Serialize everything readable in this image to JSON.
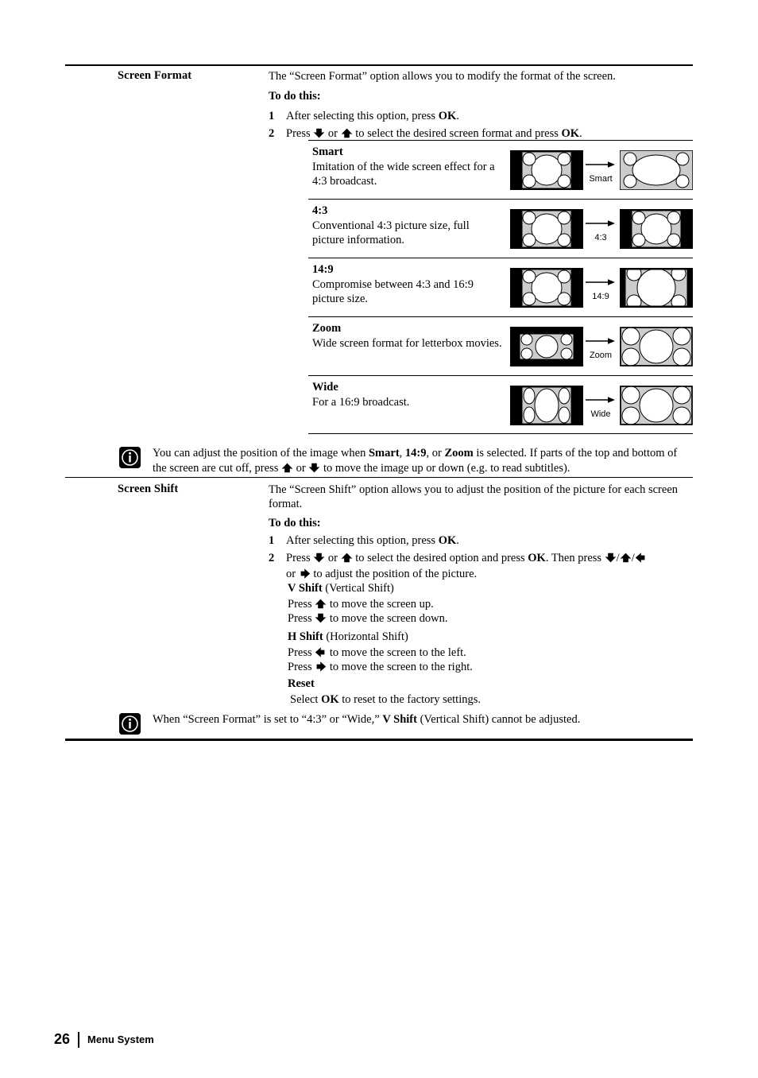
{
  "page": {
    "number": "26",
    "section": "Menu System"
  },
  "screen_format": {
    "label": "Screen Format",
    "intro": "The “Screen Format” option allows you to modify the format of the screen.",
    "to_do_this": "To do this:",
    "steps": [
      {
        "num": "1",
        "pre": "After selecting this option, press ",
        "bold": "OK",
        "post": "."
      },
      {
        "num": "2",
        "pre": "Press ",
        "mid": " or ",
        "post": " to select the desired screen format and press ",
        "bold": "OK",
        "tail": "."
      }
    ],
    "formats": [
      {
        "name": "Smart",
        "description": "Imitation of the wide screen effect for a 4:3 broadcast.",
        "arrow_label": "Smart"
      },
      {
        "name": "4:3",
        "description": "Conventional 4:3 picture size, full picture information.",
        "arrow_label": "4:3"
      },
      {
        "name": "14:9",
        "description": "Compromise between 4:3 and 16:9 picture size.",
        "arrow_label": "14:9"
      },
      {
        "name": "Zoom",
        "description": "Wide screen format for letterbox movies.",
        "arrow_label": "Zoom"
      },
      {
        "name": "Wide",
        "description": "For a 16:9 broadcast.",
        "arrow_label": "Wide"
      }
    ]
  },
  "note_1": {
    "icon": "info-icon",
    "part1": "You can adjust the position of the image when ",
    "b1": "Smart",
    "part2": ", ",
    "b2": "14:9",
    "part3": ", or ",
    "b3": "Zoom",
    "part4": " is selected. If parts of the top and bottom of the screen are cut off, press ",
    "part5": " or ",
    "part6": " to move the image up or down (e.g. to read subtitles)."
  },
  "screen_shift": {
    "label": "Screen Shift",
    "intro": "The “Screen Shift” option allows you to adjust the position of the picture for each screen format.",
    "to_do_this": "To do this:",
    "step1": {
      "num": "1",
      "pre": "After selecting this option, press ",
      "bold": "OK",
      "post": "."
    },
    "step2": {
      "num": "2",
      "pre": "Press ",
      "mid": " or ",
      "post": " to select the desired option and press ",
      "bold": "OK",
      "tail": ". Then press ",
      "line2_pre": "or ",
      "line2_post": " to adjust the position of the picture."
    },
    "v_shift": {
      "head_bold": "V Shift",
      "head_rest": " (Vertical Shift)",
      "line1_pre": "Press ",
      "line1_post": " to move the screen up.",
      "line2_pre": "Press ",
      "line2_post": " to move the screen down."
    },
    "h_shift": {
      "head_bold": "H Shift",
      "head_rest": " (Horizontal Shift)",
      "line1_pre": "Press ",
      "line1_post": " to move the screen to the left.",
      "line2_pre": "Press ",
      "line2_post": " to move the screen to the right."
    },
    "reset": {
      "head": "Reset",
      "line_pre": "Select ",
      "line_bold": "OK",
      "line_post": " to reset to the factory settings."
    }
  },
  "note_2": {
    "icon": "info-icon",
    "part1": "When “Screen Format” is set to “4:3” or “Wide,” ",
    "b1": "V Shift",
    "part2": " (Vertical Shift) cannot be adjusted."
  },
  "colors": {
    "ink": "#000000",
    "screen_fill": "#cccccc",
    "paper": "#ffffff"
  }
}
